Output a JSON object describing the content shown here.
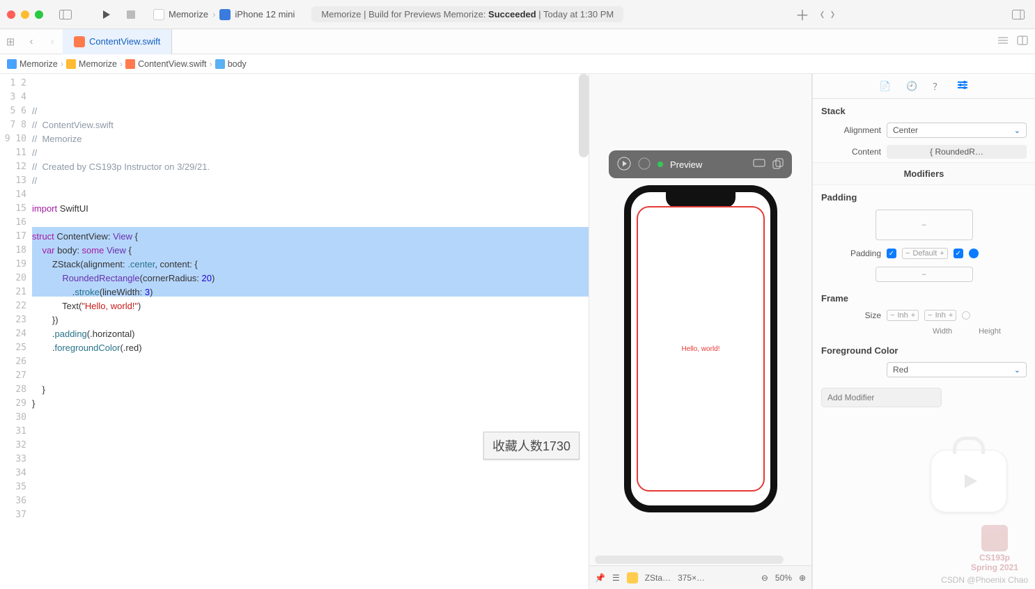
{
  "toolbar": {
    "scheme_app": "Memorize",
    "scheme_device": "iPhone 12 mini",
    "status_prefix": "Memorize | Build for Previews Memorize: ",
    "status_result": "Succeeded",
    "status_time": " | Today at 1:30 PM"
  },
  "tab": {
    "filename": "ContentView.swift"
  },
  "breadcrumb": {
    "project": "Memorize",
    "folder": "Memorize",
    "file": "ContentView.swift",
    "symbol": "body"
  },
  "code": {
    "lines_total": 37,
    "selected_from": 12,
    "selected_to": 16,
    "l1": "//",
    "l2": "//  ContentView.swift",
    "l3": "//  Memorize",
    "l4": "//",
    "l5": "//  Created by CS193p Instructor on 3/29/21.",
    "l6": "//",
    "l7": "",
    "l8_a": "import",
    "l8_b": " SwiftUI",
    "l10_a": "struct",
    "l10_b": " ContentView: ",
    "l10_c": "View",
    "l10_d": " {",
    "l11_a": "    var",
    "l11_b": " body: ",
    "l11_c": "some",
    "l11_d": " View",
    "l11_e": " {",
    "l12_a": "        ZStack(alignment: ",
    "l12_b": ".center",
    "l12_c": ", content: {",
    "l13_a": "            RoundedRectangle",
    "l13_b": "(cornerRadius: ",
    "l13_c": "20",
    "l13_d": ")",
    "l14_a": "                .",
    "l14_b": "stroke",
    "l14_c": "(lineWidth: ",
    "l14_d": "3",
    "l14_e": ")",
    "l15_a": "            Text(",
    "l15_b": "\"Hello, world!\"",
    "l15_c": ")",
    "l16": "        })",
    "l17_a": "        .",
    "l17_b": "padding",
    "l17_c": "(.horizontal)",
    "l18_a": "        .",
    "l18_b": "foregroundColor",
    "l18_c": "(.red)",
    "l21": "    }",
    "l22": "}"
  },
  "preview": {
    "label": "Preview",
    "hello": "Hello, world!",
    "footer_name": "ZSta…",
    "footer_dims": "375×…",
    "footer_zoom": "50%"
  },
  "inspector": {
    "stack_title": "Stack",
    "alignment_label": "Alignment",
    "alignment_value": "Center",
    "content_label": "Content",
    "content_value": "{ RoundedR…",
    "modifiers_title": "Modifiers",
    "padding_title": "Padding",
    "padding_label": "Padding",
    "padding_default": "Default",
    "frame_title": "Frame",
    "size_label": "Size",
    "width_label": "Width",
    "height_label": "Height",
    "inh": "Inh",
    "fg_title": "Foreground Color",
    "fg_value": "Red",
    "add_modifier_placeholder": "Add Modifier"
  },
  "tooltip": {
    "text": "收藏人数1730"
  },
  "footer": {
    "stanford_course": "CS193p",
    "stanford_term": "Spring 2021",
    "watermark": "CSDN @Phoenix Chao"
  }
}
